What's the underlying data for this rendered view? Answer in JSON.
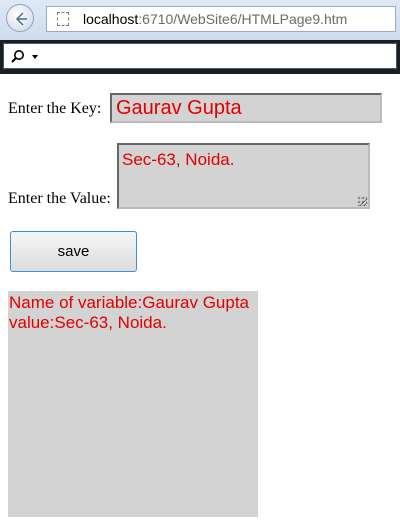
{
  "browser": {
    "url_host": "localhost",
    "url_path": ":6710/WebSite6/HTMLPage9.htm"
  },
  "form": {
    "key_label": "Enter the Key:",
    "key_value": "Gaurav Gupta",
    "value_label": "Enter the Value:",
    "value_text": "Sec-63, Noida.",
    "save_label": "save"
  },
  "output": {
    "line1": "Name of variable:Gaurav Gupta",
    "line2": "value:Sec-63, Noida."
  },
  "colors": {
    "text_accent": "#e00000",
    "field_background": "#d3d3d3",
    "button_border": "#3c8fd4"
  },
  "icons": [
    "back-arrow-icon",
    "page-icon",
    "search-icon",
    "chevron-down-icon"
  ]
}
